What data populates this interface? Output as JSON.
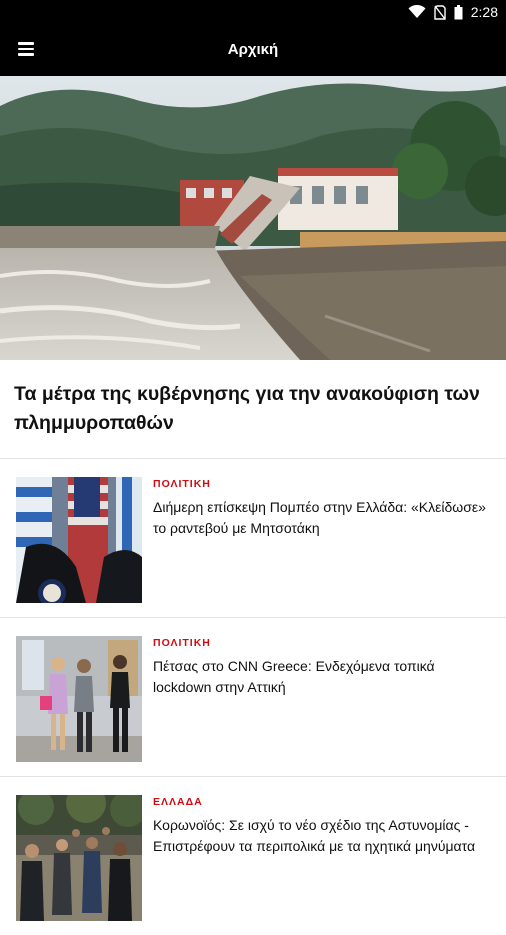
{
  "status_bar": {
    "time": "2:28"
  },
  "app_bar": {
    "title": "Αρχική"
  },
  "hero": {
    "title": "Τα μέτρα της κυβέρνησης για την ανακούφιση των πλημμυροπαθών"
  },
  "articles": [
    {
      "category": "ΠΟΛΙΤΙΚΗ",
      "title": "Διήμερη επίσκεψη Πομπέο στην Ελλάδα: «Κλείδωσε» το ραντεβού με Μητσοτάκη"
    },
    {
      "category": "ΠΟΛΙΤΙΚΗ",
      "title": "Πέτσας στο CNN Greece: Ενδεχόμενα τοπικά lockdown στην Αττική"
    },
    {
      "category": "ΕΛΛΑΔΑ",
      "title": "Κορωνοϊός: Σε ισχύ το νέο σχέδιο της Αστυνομίας - Επιστρέφουν τα περιπολικά με τα ηχητικά μηνύματα"
    }
  ],
  "colors": {
    "accent": "#d10a11",
    "bar": "#000000"
  },
  "icons": [
    "wifi-icon",
    "no-sim-icon",
    "battery-icon",
    "menu-icon"
  ]
}
